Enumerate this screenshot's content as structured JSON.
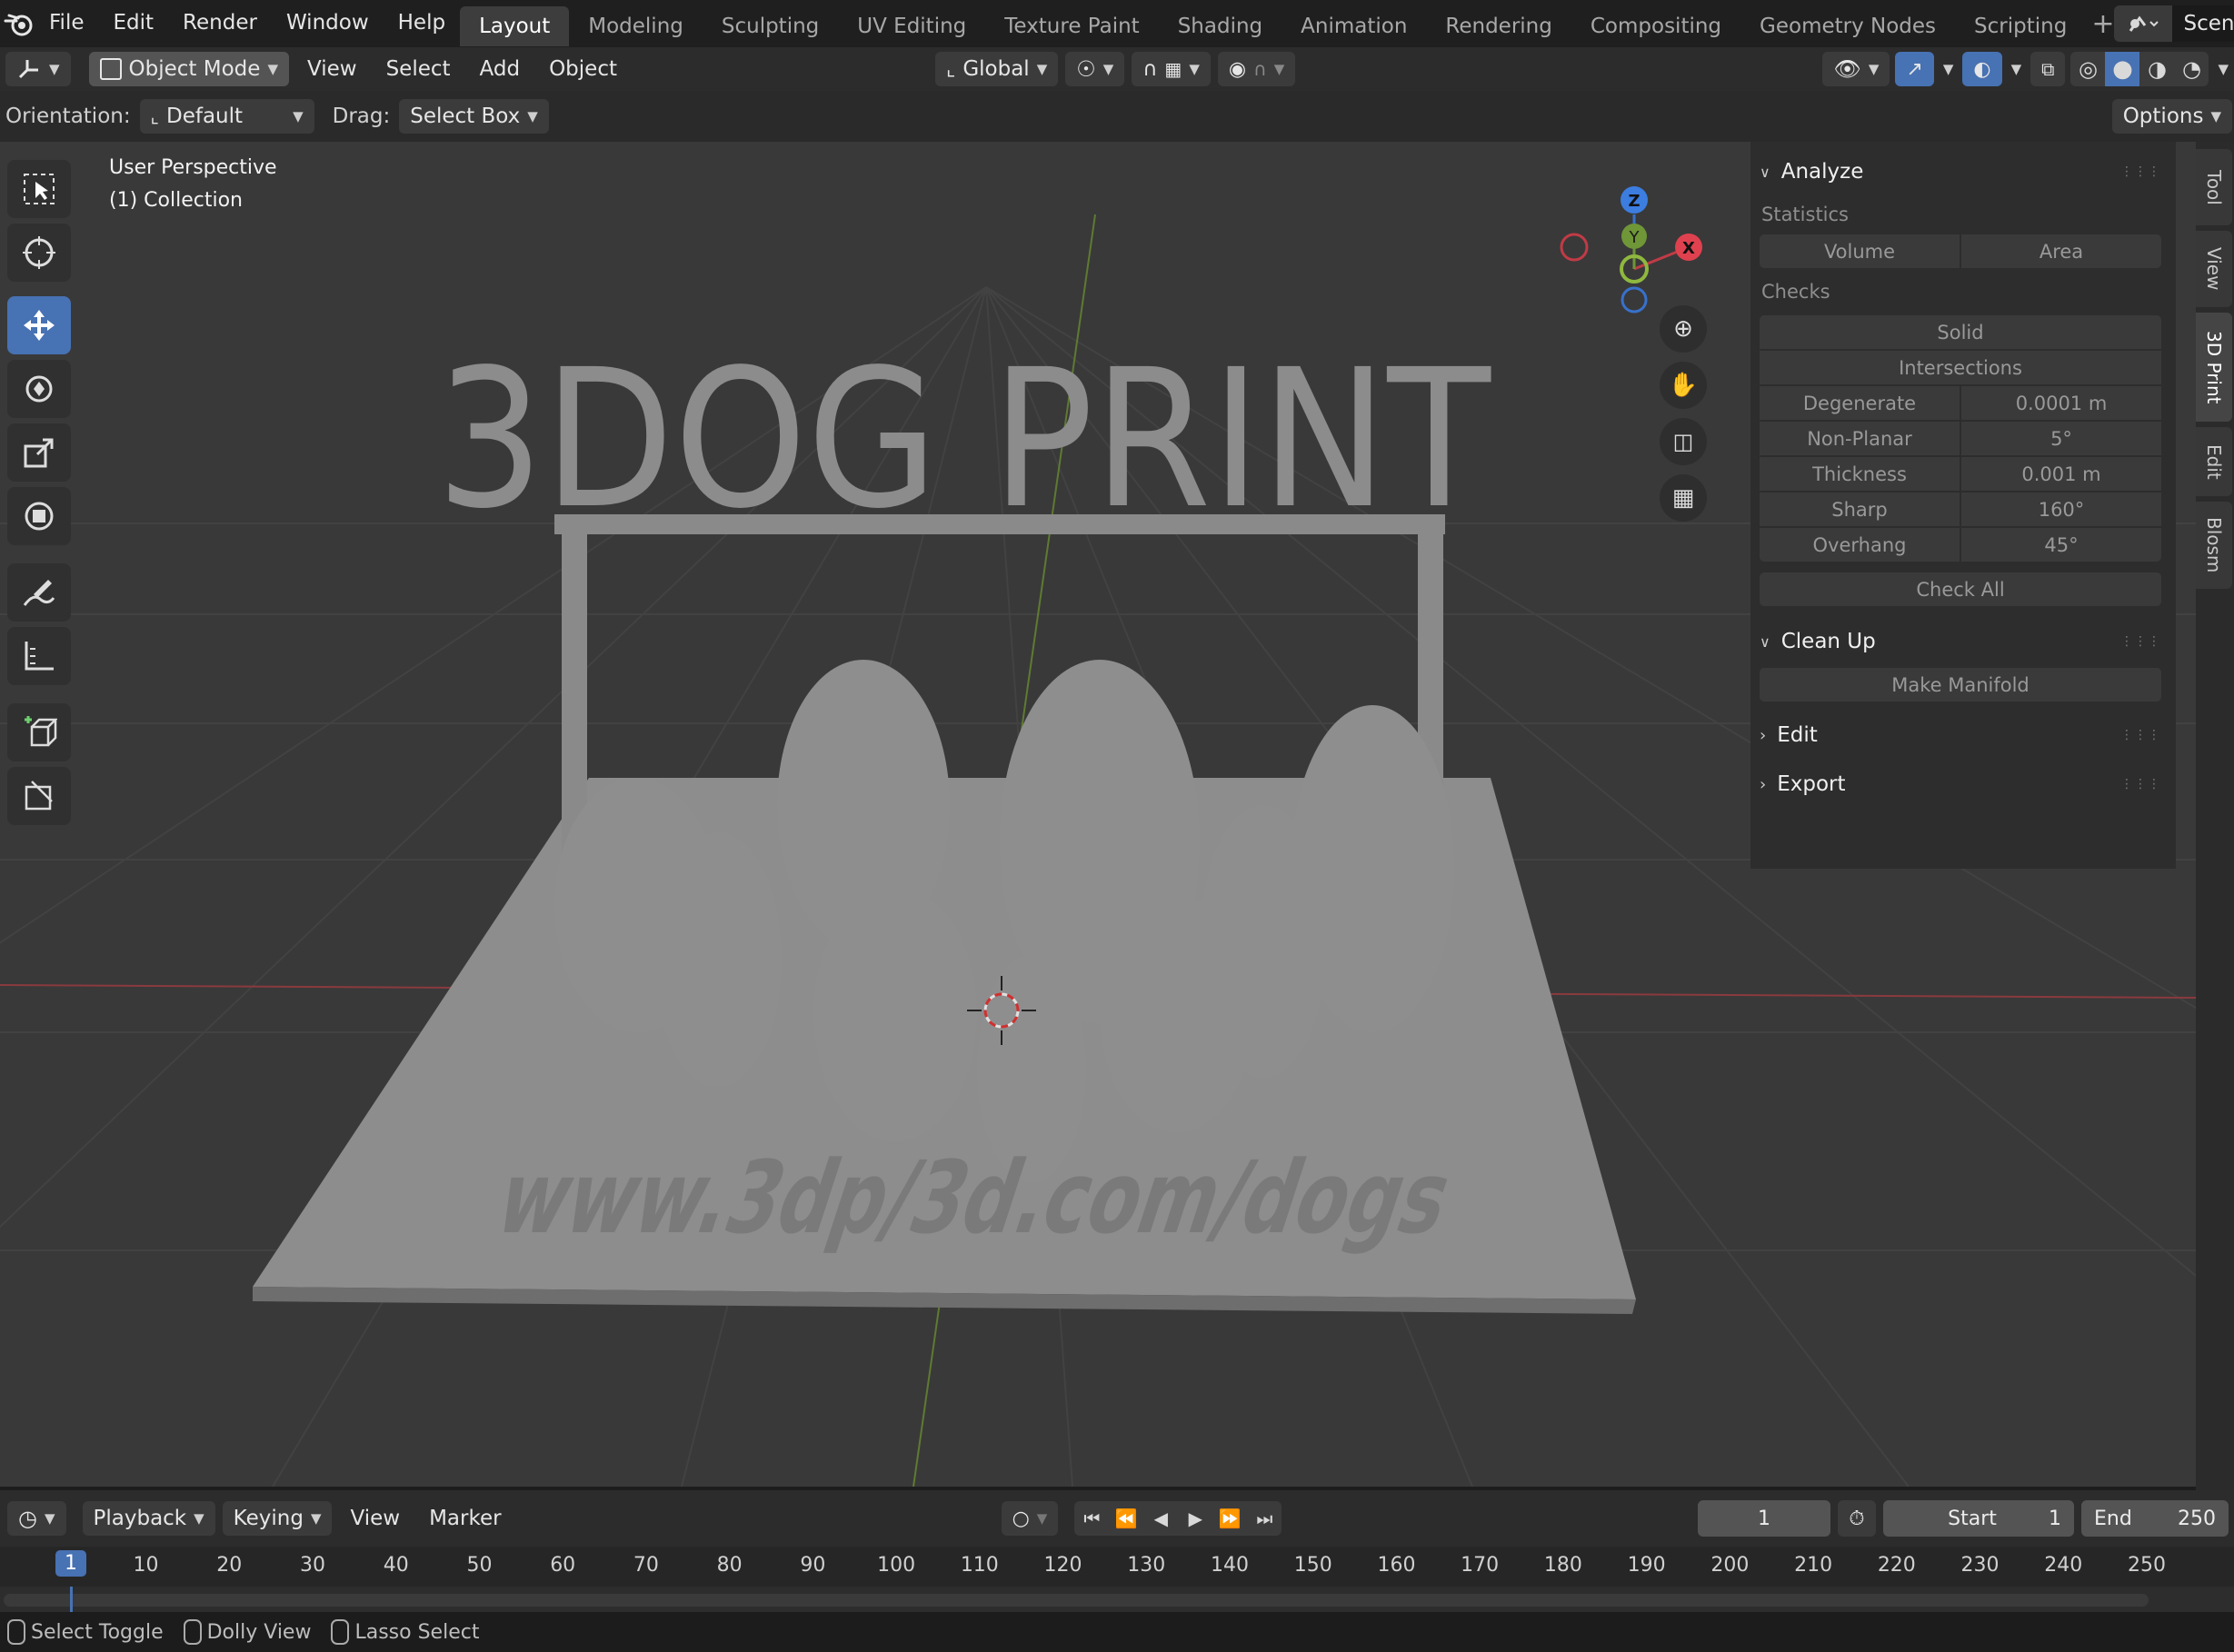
{
  "menu": {
    "items": [
      "File",
      "Edit",
      "Render",
      "Window",
      "Help"
    ]
  },
  "workspaces": {
    "tabs": [
      "Layout",
      "Modeling",
      "Sculpting",
      "UV Editing",
      "Texture Paint",
      "Shading",
      "Animation",
      "Rendering",
      "Compositing",
      "Geometry Nodes",
      "Scripting"
    ],
    "active": "Layout"
  },
  "scene": {
    "label": "Scene"
  },
  "header": {
    "mode": "Object Mode",
    "menus": [
      "View",
      "Select",
      "Add",
      "Object"
    ],
    "transform_orientation": "Global"
  },
  "tool_settings": {
    "orientation_label": "Orientation:",
    "orientation_value": "Default",
    "drag_label": "Drag:",
    "drag_value": "Select Box",
    "options_label": "Options"
  },
  "viewport": {
    "view_name": "User Perspective",
    "collection": "(1) Collection",
    "gizmo": {
      "x": "X",
      "y": "Y",
      "z": "Z"
    },
    "scene_text": {
      "title": "3DOG PRINT",
      "base_text": "www.3dp/3d.com/dogs"
    }
  },
  "npanel": {
    "analyze": {
      "title": "Analyze",
      "statistics_label": "Statistics",
      "volume": "Volume",
      "area": "Area",
      "checks_label": "Checks",
      "solid": "Solid",
      "intersections": "Intersections",
      "rows": [
        {
          "label": "Degenerate",
          "value": "0.0001 m"
        },
        {
          "label": "Non-Planar",
          "value": "5°"
        },
        {
          "label": "Thickness",
          "value": "0.001 m"
        },
        {
          "label": "Sharp",
          "value": "160°"
        },
        {
          "label": "Overhang",
          "value": "45°"
        }
      ],
      "check_all": "Check All"
    },
    "cleanup": {
      "title": "Clean Up",
      "make_manifold": "Make Manifold"
    },
    "edit": {
      "title": "Edit"
    },
    "export": {
      "title": "Export"
    },
    "tabs": [
      "Tool",
      "View",
      "3D Print",
      "Edit",
      "Blosm"
    ],
    "active_tab": "3D Print"
  },
  "timeline": {
    "menus": [
      "Playback",
      "Keying",
      "View",
      "Marker"
    ],
    "current_frame": "1",
    "start_label": "Start",
    "start": "1",
    "end_label": "End",
    "end": "250",
    "ticks": [
      "1",
      "10",
      "20",
      "30",
      "40",
      "50",
      "60",
      "70",
      "80",
      "90",
      "100",
      "110",
      "120",
      "130",
      "140",
      "150",
      "160",
      "170",
      "180",
      "190",
      "200",
      "210",
      "220",
      "230",
      "240",
      "250"
    ]
  },
  "status": {
    "items": [
      "Select Toggle",
      "Dolly View",
      "Lasso Select"
    ]
  },
  "colors": {
    "accent": "#4772b3",
    "x_axis": "#e0414f",
    "y_axis": "#7ea83a",
    "z_axis": "#3c7de0",
    "viewport_bg": "#393939"
  }
}
